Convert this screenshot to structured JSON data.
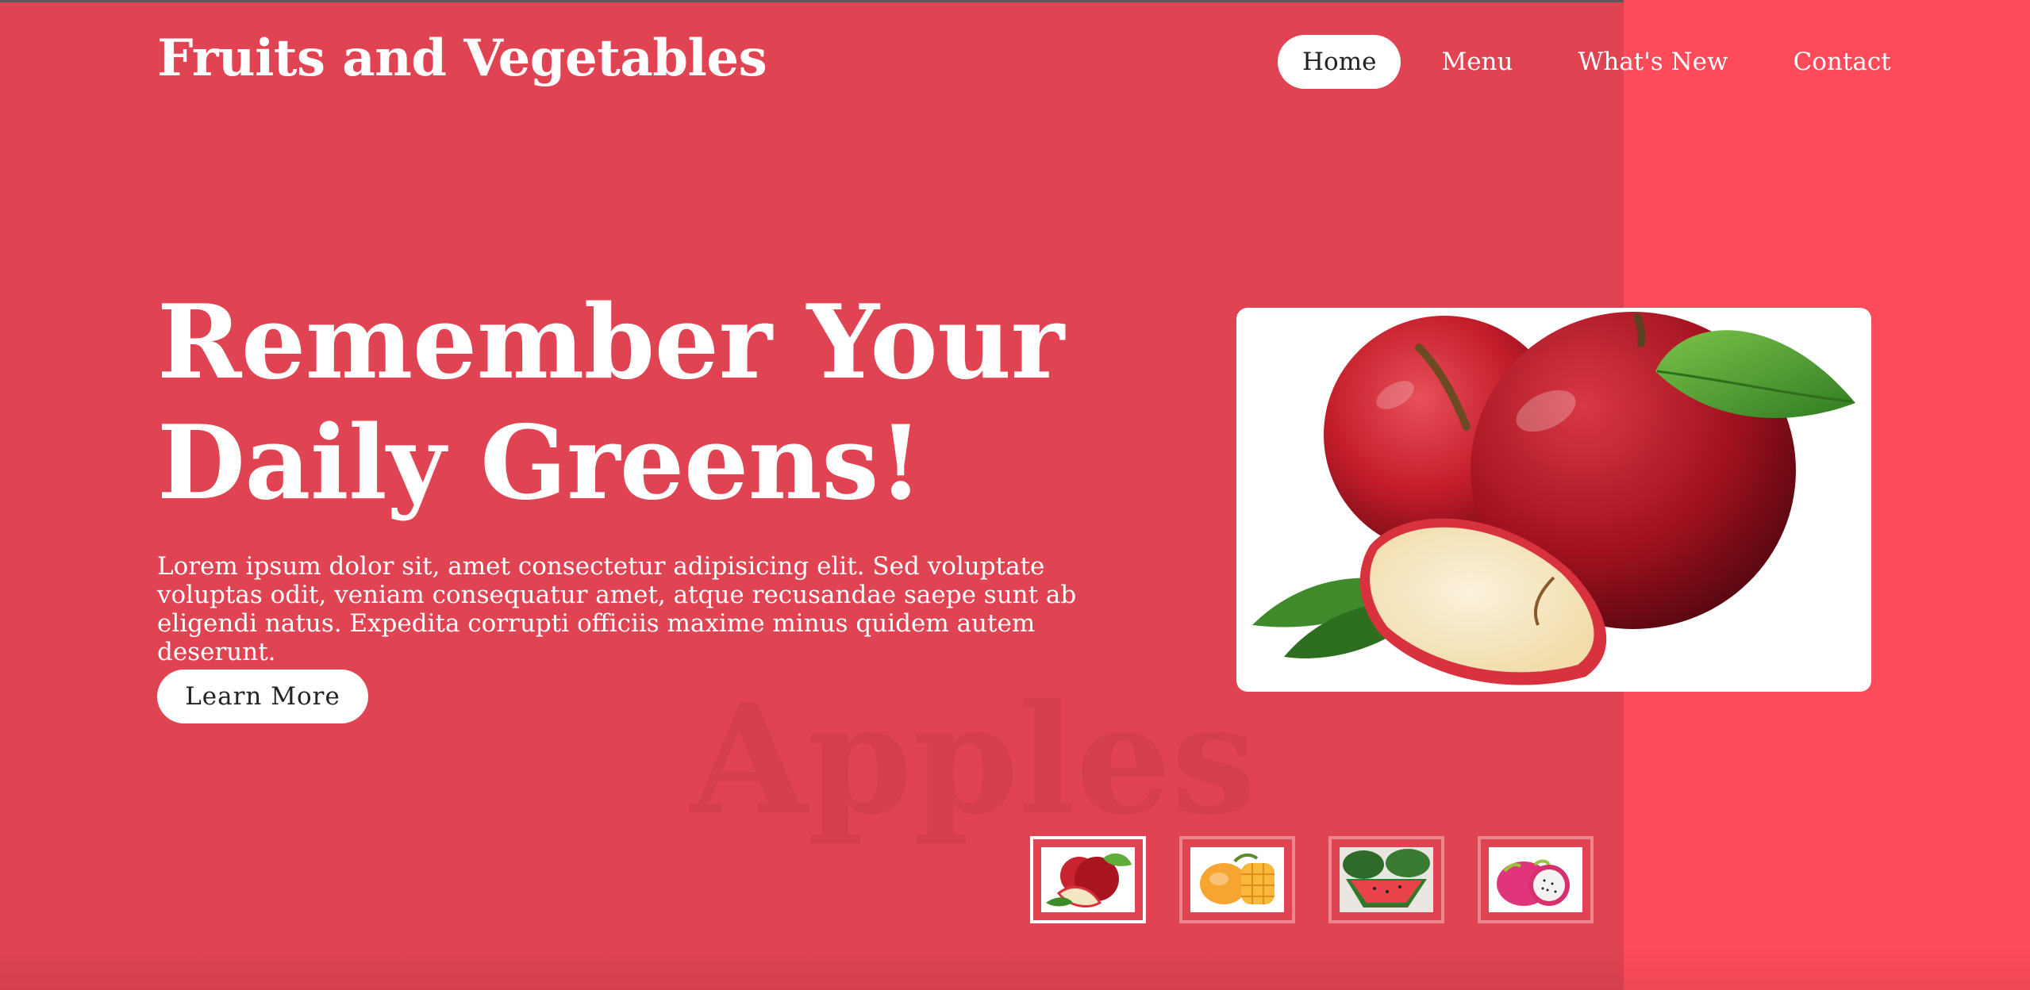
{
  "brand": "Fruits and Vegetables",
  "nav": {
    "items": [
      {
        "label": "Home",
        "active": true
      },
      {
        "label": "Menu",
        "active": false
      },
      {
        "label": "What's New",
        "active": false
      },
      {
        "label": "Contact",
        "active": false
      }
    ]
  },
  "hero": {
    "headline_line1": "Remember Your",
    "headline_line2": "Daily Greens!",
    "body": "Lorem ipsum dolor sit, amet consectetur adipisicing elit. Sed voluptate voluptas odit, veniam consequatur amet, atque recusandae saepe sunt ab eligendi natus. Expedita corrupti officiis maxime minus quidem autem deserunt.",
    "cta_label": "Learn More",
    "watermark": "Apples",
    "image_icon": "apple-image"
  },
  "thumbnails": [
    {
      "icon": "apple-thumbnail",
      "selected": true
    },
    {
      "icon": "mango-thumbnail",
      "selected": false
    },
    {
      "icon": "watermelon-thumbnail",
      "selected": false
    },
    {
      "icon": "dragonfruit-thumbnail",
      "selected": false
    }
  ],
  "colors": {
    "background": "#e04452",
    "accent_panel": "#fe4b5a",
    "button_bg": "#ffffff",
    "button_text": "#222222"
  }
}
